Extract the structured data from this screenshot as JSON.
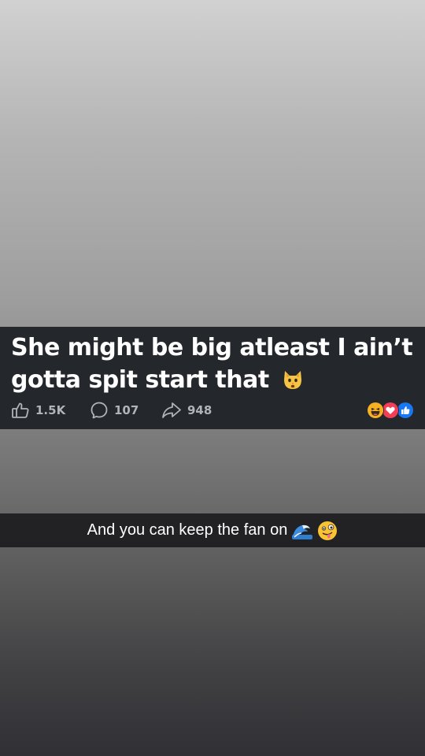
{
  "post": {
    "text": "She might be big atleast I ain’t gotta spit start that",
    "text_emoji": "cat-face-emoji",
    "likes": "1.5K",
    "comments": "107",
    "shares": "948",
    "reactions": [
      "haha-reaction-icon",
      "love-reaction-icon",
      "like-reaction-icon"
    ]
  },
  "caption": {
    "text": "And you can keep the fan on",
    "emojis": [
      "water-wave-emoji",
      "zany-face-emoji"
    ]
  },
  "colors": {
    "card_background": "#24272b",
    "action_gray": "#b0b3b8",
    "like_blue": "#1877f2",
    "love_red": "#f33e58",
    "haha_yellow": "#f7b125"
  }
}
